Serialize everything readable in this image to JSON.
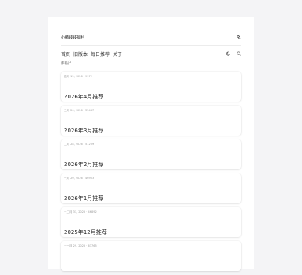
{
  "header": {
    "site_title": "小猪钱钱福利",
    "rss_icon": "rss-icon"
  },
  "nav": {
    "links": [
      {
        "label": "首页"
      },
      {
        "label": "旧版本"
      },
      {
        "label": "每日推荐"
      },
      {
        "label": "关于"
      }
    ],
    "theme_icon": "moon-icon",
    "search_icon": "search-icon"
  },
  "breadcrumb": "那笔户",
  "posts": [
    {
      "meta": "四月 15, 2026 · 9972",
      "title": "2026年4月推荐"
    },
    {
      "meta": "三月 20, 2026 · 35487",
      "title": "2026年3月推荐"
    },
    {
      "meta": "二月 28, 2026 · 51209",
      "title": "2026年2月推荐"
    },
    {
      "meta": "一月 20, 2026 · 46953",
      "title": "2026年1月推荐"
    },
    {
      "meta": "十二月 31, 2025 · 46892",
      "title": "2025年12月推荐"
    },
    {
      "meta": "十一月 29, 2025 · 63765",
      "title": ""
    }
  ]
}
